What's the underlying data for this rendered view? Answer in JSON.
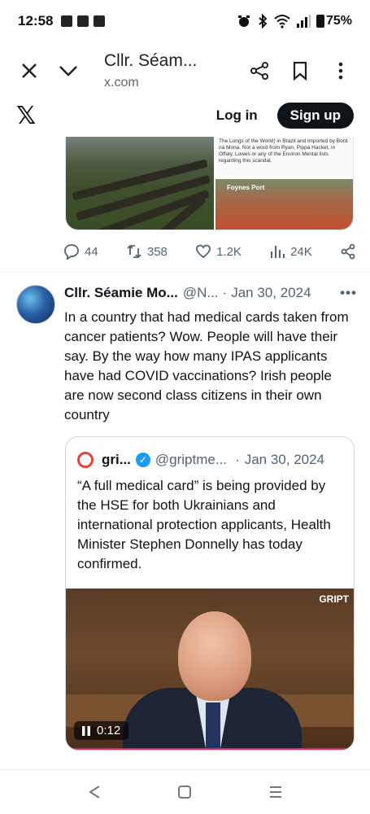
{
  "status_bar": {
    "time": "12:58",
    "battery": "75%"
  },
  "browser": {
    "title": "Cllr. Séam...",
    "url": "x.com"
  },
  "x_header": {
    "logo": "𝕏",
    "login_label": "Log in",
    "signup_label": "Sign up"
  },
  "previous_tweet": {
    "media_caption": "The Lungs of the World) in Brazil and imported by Bord na Mona. Not a word from Ryan, Pippa Hacket, in Offaly, Lowes or any of the Environ Mental lists regarding this scandal.",
    "photo_label": "Foynes Port",
    "stats": {
      "replies": "44",
      "reposts": "358",
      "likes": "1.2K",
      "views": "24K"
    }
  },
  "tweet": {
    "author": "Cllr. Séamie Mo...",
    "handle": "@N...",
    "separator": "·",
    "date": "Jan 30, 2024",
    "more": "•••",
    "text": "In a country that had medical cards taken from cancer patients? Wow. People will have their say. By the way how many IPAS applicants have had COVID vaccinations? Irish people are now second class citizens in their own country"
  },
  "quote": {
    "author": "gri...",
    "handle": "@griptme...",
    "separator": "·",
    "date": "Jan 30, 2024",
    "text": "“A full medical card” is being provided by the HSE for both Ukrainians and international protection applicants, Health Minister Stephen Donnelly has today confirmed.",
    "video": {
      "brand": "GRIPT",
      "time": "0:12"
    }
  },
  "colors": {
    "accent": "#1d9bf0",
    "text": "#0f1419",
    "muted": "#536471",
    "gript_red": "#e8413a"
  }
}
